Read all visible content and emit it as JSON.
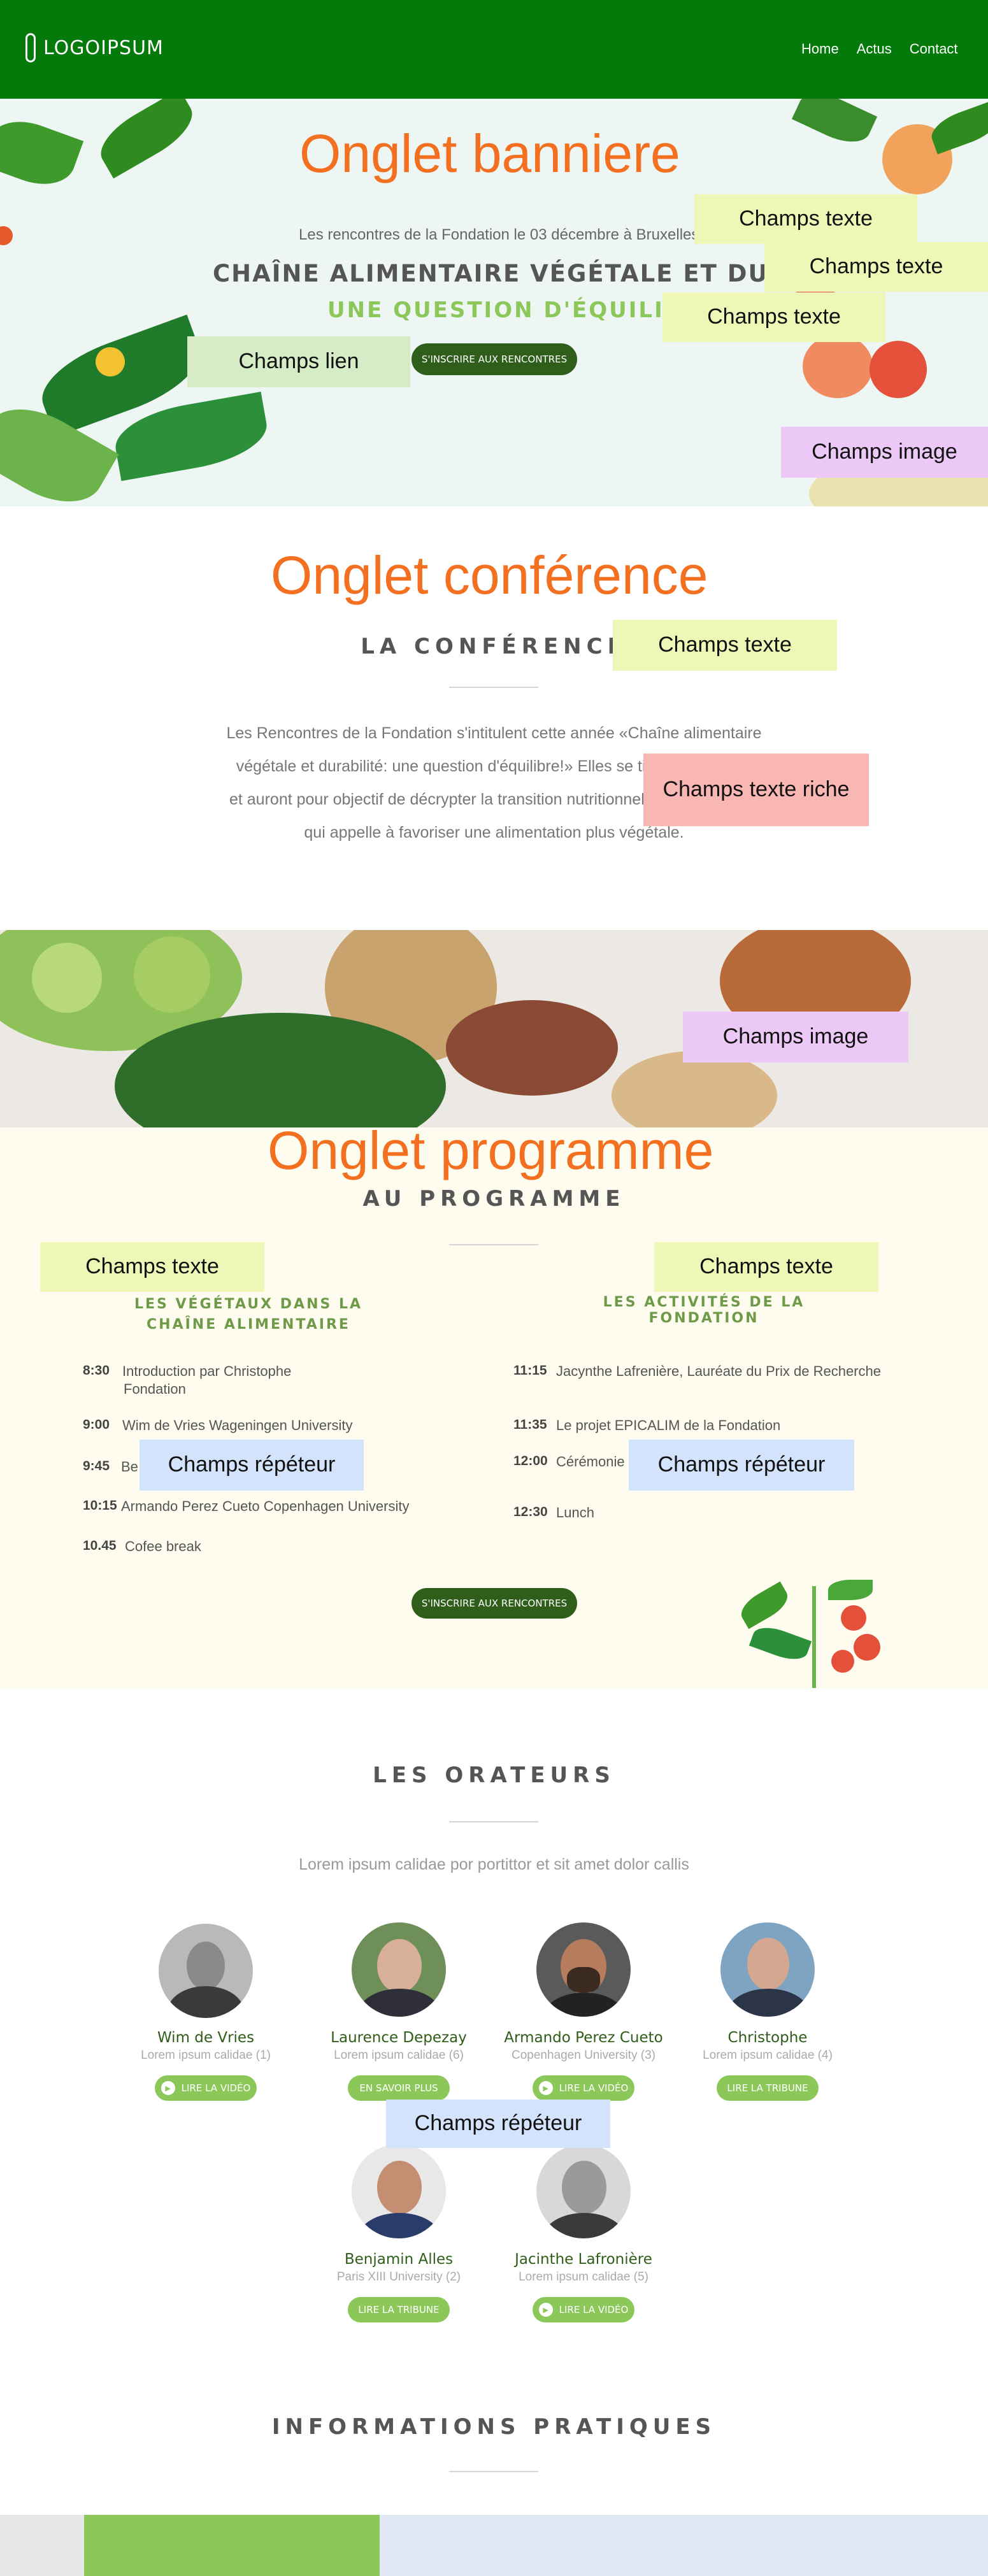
{
  "header": {
    "logo_text": "LOGOIPSUM",
    "nav": [
      "Home",
      "Actus",
      "Contact"
    ],
    "bg_color": "#047a0b"
  },
  "banner": {
    "onglet_label": "Onglet banniere",
    "date_line": "Les rencontres de la Fondation le 03 décembre à Bruxelles",
    "title": "CHAÎNE ALIMENTAIRE VÉGÉTALE ET DURABILITÉ",
    "subtitle": "UNE QUESTION D'ÉQUILIBRE !",
    "cta": "S'INSCRIRE AUX RENCONTRES",
    "tags": {
      "texte_1": "Champs texte",
      "texte_2": "Champs texte",
      "texte_3": "Champs texte",
      "lien": "Champs lien",
      "image": "Champs image"
    }
  },
  "conference": {
    "onglet_label": "Onglet conférence",
    "title": "LA CONFÉRENCE",
    "lines": [
      "Les Rencontres de la Fondation   s'intitulent cette année «Chaîne alimentaire",
      "végétale et durabilité: une question d'équilibre!» Elles se tiendront le 3 dé",
      "et auront pour objectif de décrypter la transition nutritionnelle des systèmes",
      "qui appelle à favoriser une alimentation plus végétale."
    ],
    "tags": {
      "texte": "Champs texte",
      "texte_riche": "Champs texte riche"
    }
  },
  "image_band": {
    "tag": "Champs image"
  },
  "programme": {
    "onglet_label": "Onglet programme",
    "title": "AU PROGRAMME",
    "left_heading": "LES VÉGÉTAUX DANS LA CHAÎNE ALIMENTAIRE",
    "right_heading": "LES ACTIVITÉS DE LA FONDATION",
    "left_items": [
      {
        "time": "8:30",
        "text": "Introduction par Christophe",
        "text2": "Fondation"
      },
      {
        "time": "9:00",
        "text": "Wim de Vries Wageningen University",
        "text2": ""
      },
      {
        "time": "9:45",
        "text": "Be",
        "text2": ""
      },
      {
        "time": "10:15",
        "text": "Armando Perez Cueto Copenhagen University",
        "text2": ""
      },
      {
        "time": "10.45",
        "text": "Cofee break",
        "text2": ""
      }
    ],
    "right_items": [
      {
        "time": "11:15",
        "text": "Jacynthe Lafrenière, Lauréate du Prix de Recherche"
      },
      {
        "time": "11:35",
        "text": "Le projet EPICALIM de la Fondation"
      },
      {
        "time": "12:00",
        "text": "Cérémonie"
      },
      {
        "time": "12:30",
        "text": "Lunch"
      }
    ],
    "cta": "S'INSCRIRE AUX RENCONTRES",
    "tags": {
      "texte_left": "Champs texte",
      "texte_right": "Champs texte",
      "repeteur_left": "Champs répéteur",
      "repeteur_right": "Champs répéteur"
    }
  },
  "orateurs": {
    "title": "LES ORATEURS",
    "intro": "Lorem ipsum calidae por portittor et sit amet dolor callis",
    "speakers": [
      {
        "name": "Wim de Vries",
        "sub": "Lorem ipsum calidae (1)",
        "button": "LIRE LA VIDÉO",
        "play": true
      },
      {
        "name": "Laurence Depezay",
        "sub": "Lorem ipsum calidae (6)",
        "button": "EN SAVOIR PLUS",
        "play": false
      },
      {
        "name": "Armando Perez Cueto",
        "sub": "Copenhagen University (3)",
        "button": "LIRE LA VIDÉO",
        "play": true
      },
      {
        "name": "Christophe",
        "sub": "Lorem ipsum calidae (4)",
        "button": "LIRE LA TRIBUNE",
        "play": false
      },
      {
        "name": "Benjamin Alles",
        "sub": "Paris XIII University (2)",
        "button": "LIRE LA TRIBUNE",
        "play": false
      },
      {
        "name": "Jacinthe Lafronière",
        "sub": "Lorem ipsum calidae (5)",
        "button": "LIRE LA VIDÉO",
        "play": true
      }
    ],
    "tag": "Champs répéteur"
  },
  "infos": {
    "title": "INFORMATIONS PRATIQUES"
  },
  "colors": {
    "accent_orange": "#f37021",
    "dark_green": "#2f5d1a",
    "light_green": "#8cc75a",
    "programme_bg": "#fefcee"
  }
}
